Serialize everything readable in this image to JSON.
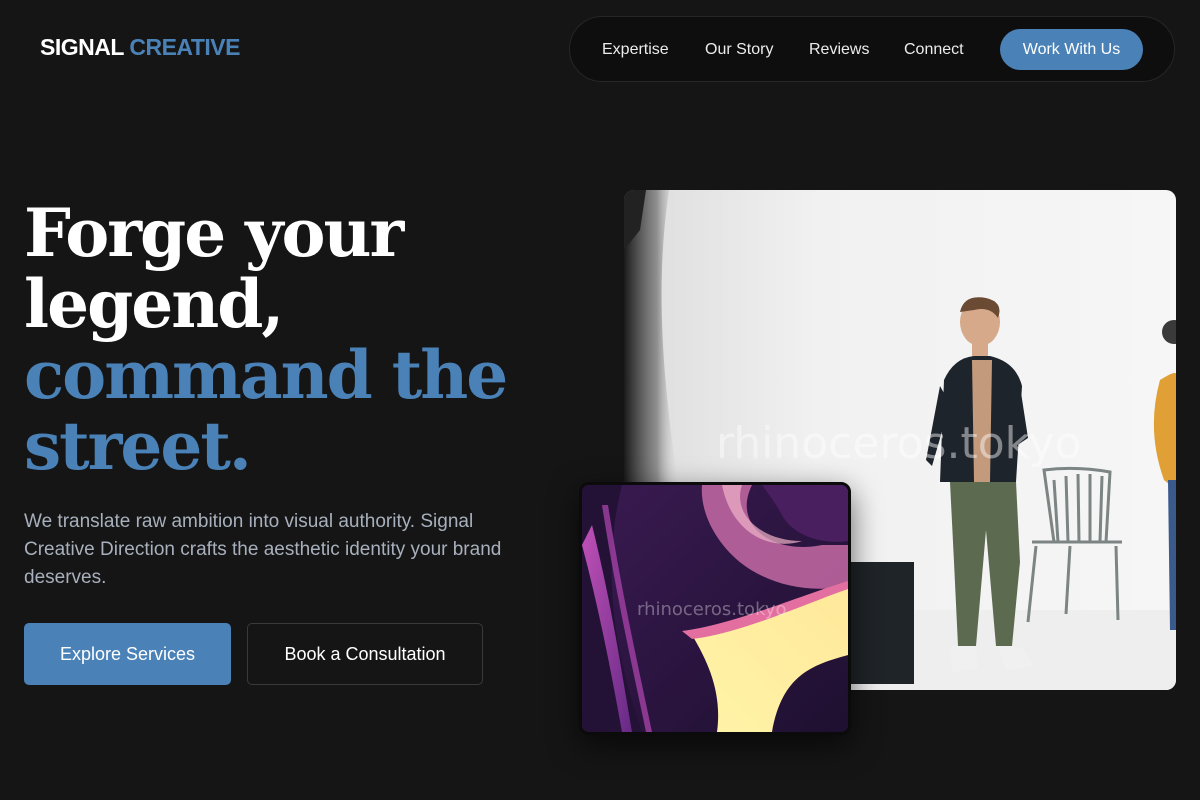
{
  "header": {
    "logo_primary": "SIGNAL",
    "logo_accent": "CREATIVE",
    "nav": [
      "Expertise",
      "Our Story",
      "Reviews",
      "Connect"
    ],
    "cta": "Work With Us"
  },
  "hero": {
    "headline_line1": "Forge your",
    "headline_line2": "legend,",
    "headline_line3": "command the",
    "headline_line4": "street.",
    "subtext": "We translate raw ambition into visual authority. Signal Creative Direction crafts the aesthetic identity your brand deserves.",
    "primary_button": "Explore Services",
    "secondary_button": "Book a Consultation"
  },
  "images": {
    "main_watermark": "rhinoceros.tokyo",
    "inset_watermark": "rhinoceros.tokyo"
  },
  "colors": {
    "background": "#151515",
    "accent": "#4a82b8",
    "text": "#ffffff",
    "muted_text": "#a7b0bc"
  }
}
